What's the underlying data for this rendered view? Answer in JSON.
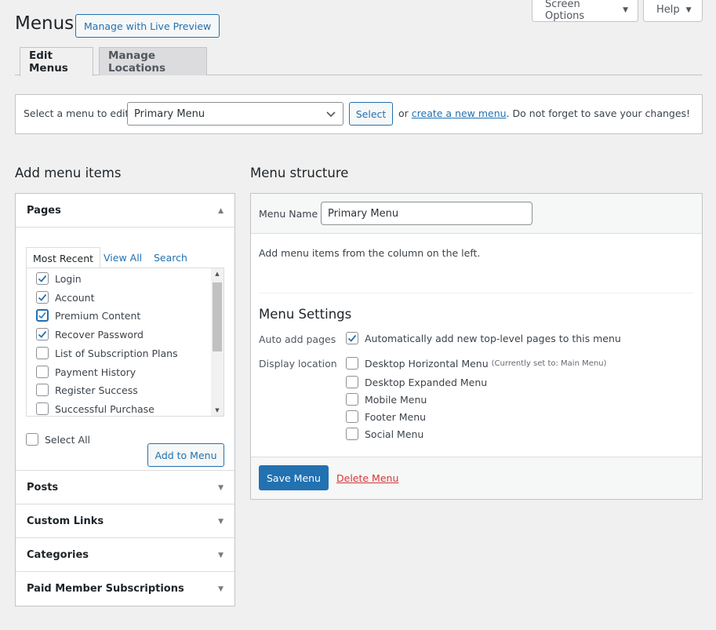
{
  "top_tabs": {
    "screen_options": "Screen Options",
    "help": "Help"
  },
  "header": {
    "title": "Menus",
    "live_preview": "Manage with Live Preview"
  },
  "nav_tabs": [
    {
      "label": "Edit Menus",
      "active": true
    },
    {
      "label": "Manage Locations",
      "active": false
    }
  ],
  "select_bar": {
    "label": "Select a menu to edit:",
    "selected_menu": "Primary Menu",
    "select_button": "Select",
    "or_text": "or",
    "create_link": "create a new menu",
    "reminder": ". Do not forget to save your changes!"
  },
  "left": {
    "heading": "Add menu items",
    "pages_panel": {
      "title": "Pages",
      "tabs": [
        "Most Recent",
        "View All",
        "Search"
      ],
      "items": [
        {
          "label": "Login",
          "checked": true
        },
        {
          "label": "Account",
          "checked": true
        },
        {
          "label": "Premium Content",
          "checked": true,
          "focused": true
        },
        {
          "label": "Recover Password",
          "checked": true
        },
        {
          "label": "List of Subscription Plans",
          "checked": false
        },
        {
          "label": "Payment History",
          "checked": false
        },
        {
          "label": "Register Success",
          "checked": false
        },
        {
          "label": "Successful Purchase",
          "checked": false
        }
      ],
      "select_all": "Select All",
      "add_button": "Add to Menu"
    },
    "collapsed_panels": [
      "Posts",
      "Custom Links",
      "Categories",
      "Paid Member Subscriptions"
    ]
  },
  "right": {
    "heading": "Menu structure",
    "menu_name_label": "Menu Name",
    "menu_name_value": "Primary Menu",
    "hint": "Add menu items from the column on the left.",
    "settings_title": "Menu Settings",
    "auto_add_label": "Auto add pages",
    "auto_add_option": "Automatically add new top-level pages to this menu",
    "display_location_label": "Display location",
    "locations": [
      {
        "label": "Desktop Horizontal Menu",
        "note": "(Currently set to: Main Menu)",
        "checked": false
      },
      {
        "label": "Desktop Expanded Menu",
        "note": "",
        "checked": false
      },
      {
        "label": "Mobile Menu",
        "note": "",
        "checked": false
      },
      {
        "label": "Footer Menu",
        "note": "",
        "checked": false
      },
      {
        "label": "Social Menu",
        "note": "",
        "checked": false
      }
    ],
    "save_button": "Save Menu",
    "delete_link": "Delete Menu"
  },
  "colors": {
    "accent": "#2271b1",
    "danger": "#d63638",
    "background": "#f0f0f1"
  }
}
